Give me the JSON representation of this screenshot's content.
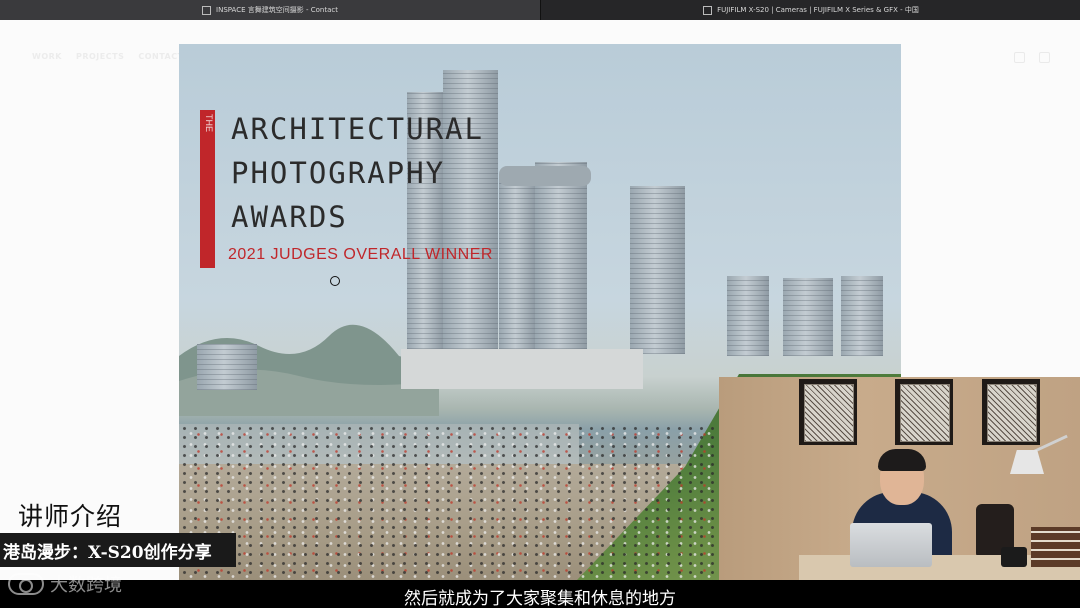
{
  "browser": {
    "tabs": [
      {
        "title": "INSPACE 言舞建筑空间摄影 - Contact",
        "active": true
      },
      {
        "title": "FUJIFILM X-S20 | Cameras | FUJIFILM X Series & GFX - 中国",
        "active": false
      }
    ]
  },
  "site": {
    "nav": [
      "WORK",
      "PROJECTS",
      "CONTACT"
    ]
  },
  "photo": {
    "award": {
      "the": "THE",
      "line1": "ARCHITECTURAL",
      "line2": "PHOTOGRAPHY",
      "line3": "AWARDS",
      "subtitle": "2021 JUDGES OVERALL WINNER"
    }
  },
  "overlay": {
    "intro_label": "讲师介绍",
    "speaker_banner": "港岛漫步：X-S20创作分享",
    "subtitle": "然后就成为了大家聚集和休息的地方",
    "watermark": "大数跨境"
  },
  "colors": {
    "award_red": "#c0262a",
    "tabbar": "#2b2b2e"
  }
}
